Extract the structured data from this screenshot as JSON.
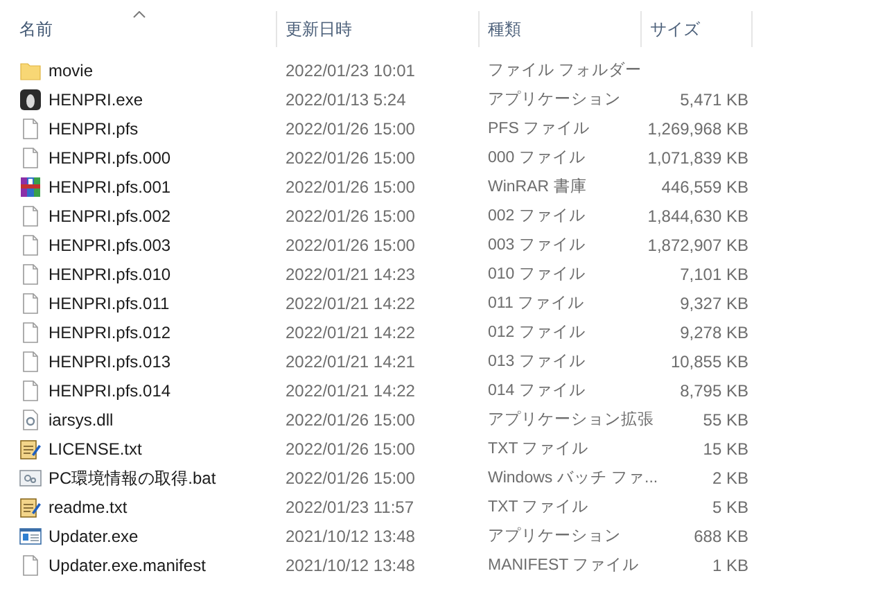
{
  "columns": [
    {
      "label": "名前",
      "sorted": true
    },
    {
      "label": "更新日時",
      "sorted": false
    },
    {
      "label": "種類",
      "sorted": false
    },
    {
      "label": "サイズ",
      "sorted": false
    }
  ],
  "files": [
    {
      "name": "movie",
      "date": "2022/01/23 10:01",
      "type": "ファイル フォルダー",
      "kind": "folder"
    },
    {
      "name": "HENPRI.exe",
      "date": "2022/01/13 5:24",
      "type": "アプリケーション",
      "size": "5,471 KB",
      "kind": "app"
    },
    {
      "name": "HENPRI.pfs",
      "date": "2022/01/26 15:00",
      "type": "PFS ファイル",
      "size": "1,269,968 KB",
      "kind": "file"
    },
    {
      "name": "HENPRI.pfs.000",
      "date": "2022/01/26 15:00",
      "type": "000 ファイル",
      "size": "1,071,839 KB",
      "kind": "file"
    },
    {
      "name": "HENPRI.pfs.001",
      "date": "2022/01/26 15:00",
      "type": "WinRAR 書庫",
      "size": "446,559 KB",
      "kind": "archive"
    },
    {
      "name": "HENPRI.pfs.002",
      "date": "2022/01/26 15:00",
      "type": "002 ファイル",
      "size": "1,844,630 KB",
      "kind": "file"
    },
    {
      "name": "HENPRI.pfs.003",
      "date": "2022/01/26 15:00",
      "type": "003 ファイル",
      "size": "1,872,907 KB",
      "kind": "file"
    },
    {
      "name": "HENPRI.pfs.010",
      "date": "2022/01/21 14:23",
      "type": "010 ファイル",
      "size": "7,101 KB",
      "kind": "file"
    },
    {
      "name": "HENPRI.pfs.011",
      "date": "2022/01/21 14:22",
      "type": "011 ファイル",
      "size": "9,327 KB",
      "kind": "file"
    },
    {
      "name": "HENPRI.pfs.012",
      "date": "2022/01/21 14:22",
      "type": "012 ファイル",
      "size": "9,278 KB",
      "kind": "file"
    },
    {
      "name": "HENPRI.pfs.013",
      "date": "2022/01/21 14:21",
      "type": "013 ファイル",
      "size": "10,855 KB",
      "kind": "file"
    },
    {
      "name": "HENPRI.pfs.014",
      "date": "2022/01/21 14:22",
      "type": "014 ファイル",
      "size": "8,795 KB",
      "kind": "file"
    },
    {
      "name": "iarsys.dll",
      "date": "2022/01/26 15:00",
      "type": "アプリケーション拡張",
      "size": "55 KB",
      "kind": "dll"
    },
    {
      "name": "LICENSE.txt",
      "date": "2022/01/26 15:00",
      "type": "TXT ファイル",
      "size": "15 KB",
      "kind": "text"
    },
    {
      "name": "PC環境情報の取得.bat",
      "date": "2022/01/26 15:00",
      "type": "Windows バッチ ファ...",
      "size": "2 KB",
      "kind": "batch"
    },
    {
      "name": "readme.txt",
      "date": "2022/01/23 11:57",
      "type": "TXT ファイル",
      "size": "5 KB",
      "kind": "text"
    },
    {
      "name": "Updater.exe",
      "date": "2021/10/12 13:48",
      "type": "アプリケーション",
      "size": "688 KB",
      "kind": "window"
    },
    {
      "name": "Updater.exe.manifest",
      "date": "2021/10/12 13:48",
      "type": "MANIFEST ファイル",
      "size": "1 KB",
      "kind": "file"
    }
  ]
}
